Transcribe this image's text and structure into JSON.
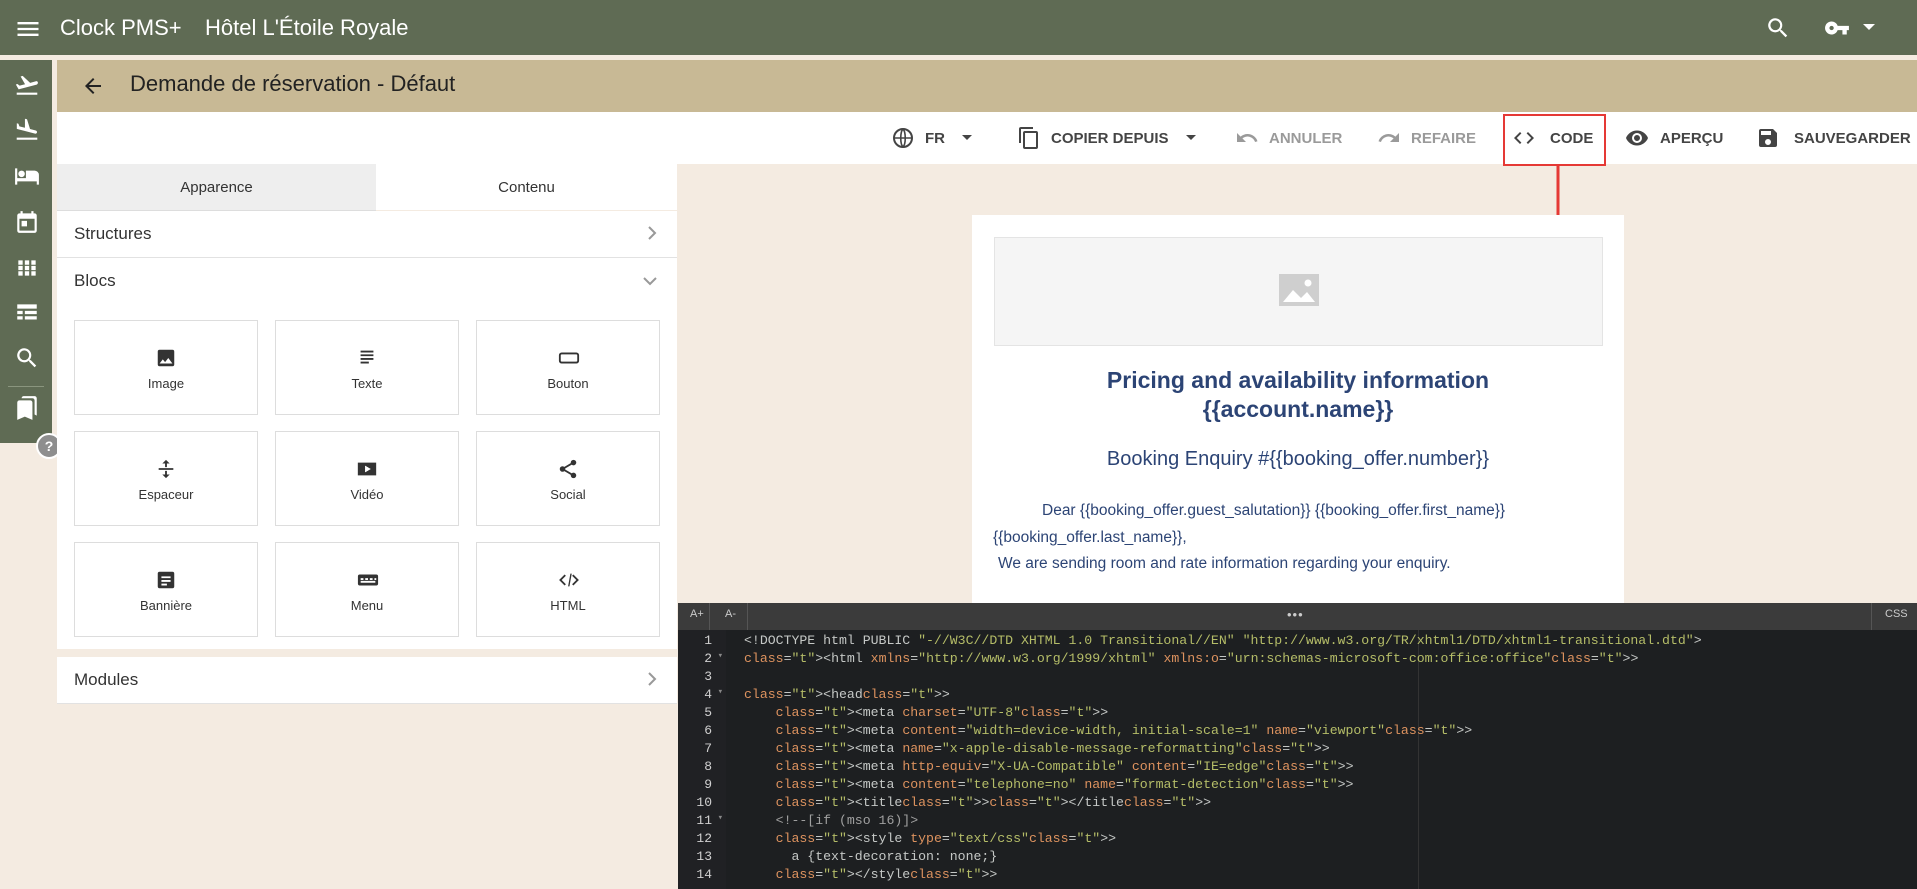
{
  "topbar": {
    "app_name": "Clock PMS+",
    "hotel_name": "Hôtel L'Étoile Royale"
  },
  "page": {
    "title": "Demande de réservation - Défaut"
  },
  "toolbar": {
    "language": "FR",
    "copy_from": "COPIER DEPUIS",
    "undo": "ANNULER",
    "redo": "REFAIRE",
    "code": "CODE",
    "preview": "APERÇU",
    "save": "SAUVEGARDER"
  },
  "left_panel": {
    "tabs": [
      "Apparence",
      "Contenu"
    ],
    "active_tab": "Contenu",
    "sections": {
      "structures": "Structures",
      "blocks": "Blocs",
      "modules": "Modules"
    },
    "blocks": [
      {
        "label": "Image",
        "icon": "image-icon"
      },
      {
        "label": "Texte",
        "icon": "text-icon"
      },
      {
        "label": "Bouton",
        "icon": "button-icon"
      },
      {
        "label": "Espaceur",
        "icon": "spacer-icon"
      },
      {
        "label": "Vidéo",
        "icon": "video-icon"
      },
      {
        "label": "Social",
        "icon": "share-icon"
      },
      {
        "label": "Bannière",
        "icon": "banner-icon"
      },
      {
        "label": "Menu",
        "icon": "menu-block-icon"
      },
      {
        "label": "HTML",
        "icon": "code-icon"
      }
    ]
  },
  "preview": {
    "title_line1": "Pricing and availability information",
    "title_line2": "{{account.name}}",
    "subtitle": "Booking Enquiry #{{booking_offer.number}}",
    "body_line1": "Dear {{booking_offer.guest_salutation}} {{booking_offer.first_name}}",
    "body_line2": "{{booking_offer.last_name}},",
    "body_line3": "We are sending room and rate information regarding your enquiry."
  },
  "editor": {
    "font_increase": "A+",
    "font_decrease": "A-",
    "drag_handle": "•••",
    "css_tab": "CSS",
    "line_numbers": [
      "1",
      "2",
      "3",
      "4",
      "5",
      "6",
      "7",
      "8",
      "9",
      "10",
      "11",
      "12",
      "13",
      "14"
    ],
    "code_lines": [
      "<!DOCTYPE html PUBLIC \"-//W3C//DTD XHTML 1.0 Transitional//EN\" \"http://www.w3.org/TR/xhtml1/DTD/xhtml1-transitional.dtd\">",
      "<html xmlns=\"http://www.w3.org/1999/xhtml\" xmlns:o=\"urn:schemas-microsoft-com:office:office\">",
      "",
      "<head>",
      "    <meta charset=\"UTF-8\">",
      "    <meta content=\"width=device-width, initial-scale=1\" name=\"viewport\">",
      "    <meta name=\"x-apple-disable-message-reformatting\">",
      "    <meta http-equiv=\"X-UA-Compatible\" content=\"IE=edge\">",
      "    <meta content=\"telephone=no\" name=\"format-detection\">",
      "    <title></title>",
      "    <!--[if (mso 16)]>",
      "    <style type=\"text/css\">",
      "      a {text-decoration: none;}",
      "    </style>"
    ]
  },
  "colors": {
    "topbar": "#5f6b54",
    "subheader": "#c8b995",
    "background": "#f4ebe1",
    "preview_text": "#2c4475",
    "highlight": "#e53935",
    "editor_bg": "#1d1f21"
  }
}
